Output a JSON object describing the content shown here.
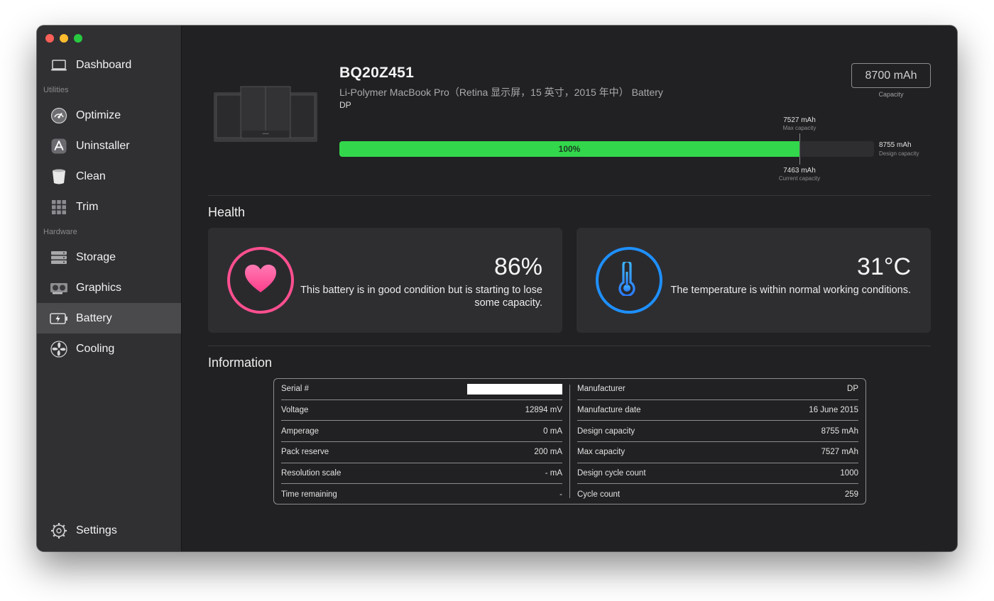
{
  "sidebar": {
    "items_top": [
      {
        "label": "Dashboard",
        "icon": "laptop-icon"
      }
    ],
    "section_utilities": "Utilities",
    "utilities": [
      {
        "label": "Optimize",
        "icon": "gauge-icon"
      },
      {
        "label": "Uninstaller",
        "icon": "app-store-icon"
      },
      {
        "label": "Clean",
        "icon": "trash-icon"
      },
      {
        "label": "Trim",
        "icon": "grid-icon"
      }
    ],
    "section_hardware": "Hardware",
    "hardware": [
      {
        "label": "Storage",
        "icon": "drive-icon"
      },
      {
        "label": "Graphics",
        "icon": "gpu-icon"
      },
      {
        "label": "Battery",
        "icon": "battery-icon",
        "active": true
      },
      {
        "label": "Cooling",
        "icon": "fan-icon"
      }
    ],
    "settings_label": "Settings"
  },
  "battery": {
    "model": "BQ20Z451",
    "description": "Li-Polymer MacBook Pro（Retina 显示屏，15 英寸，2015 年中） Battery",
    "manufacturer_code": "DP",
    "capacity_value": "8700 mAh",
    "capacity_label": "Capacity",
    "charge_percent_label": "100%",
    "charge_fraction": 1.0,
    "max_capacity_value": "7527 mAh",
    "max_capacity_label": "Max capacity",
    "current_capacity_value": "7463 mAh",
    "current_capacity_label": "Current capacity",
    "design_capacity_value": "8755 mAh",
    "design_capacity_label": "Design capacity",
    "max_to_design_ratio": 0.86
  },
  "health": {
    "title": "Health",
    "condition_value": "86%",
    "condition_text": "This battery is in good condition but is starting to lose some capacity.",
    "temperature_value": "31°C",
    "temperature_text": "The temperature is within normal working conditions."
  },
  "information": {
    "title": "Information",
    "left": [
      {
        "label": "Serial #",
        "value": ""
      },
      {
        "label": "Voltage",
        "value": "12894 mV"
      },
      {
        "label": "Amperage",
        "value": "0 mA"
      },
      {
        "label": "Pack reserve",
        "value": "200 mA"
      },
      {
        "label": "Resolution scale",
        "value": "- mA"
      },
      {
        "label": "Time remaining",
        "value": "-"
      }
    ],
    "right": [
      {
        "label": "Manufacturer",
        "value": "DP"
      },
      {
        "label": "Manufacture date",
        "value": "16 June 2015"
      },
      {
        "label": "Design capacity",
        "value": "8755 mAh"
      },
      {
        "label": "Max capacity",
        "value": "7527 mAh"
      },
      {
        "label": "Design cycle count",
        "value": "1000"
      },
      {
        "label": "Cycle count",
        "value": "259"
      }
    ]
  },
  "colors": {
    "charge_bar": "#32d74b",
    "health_ring": "#ff4f8f",
    "temp_ring": "#1e90ff"
  }
}
